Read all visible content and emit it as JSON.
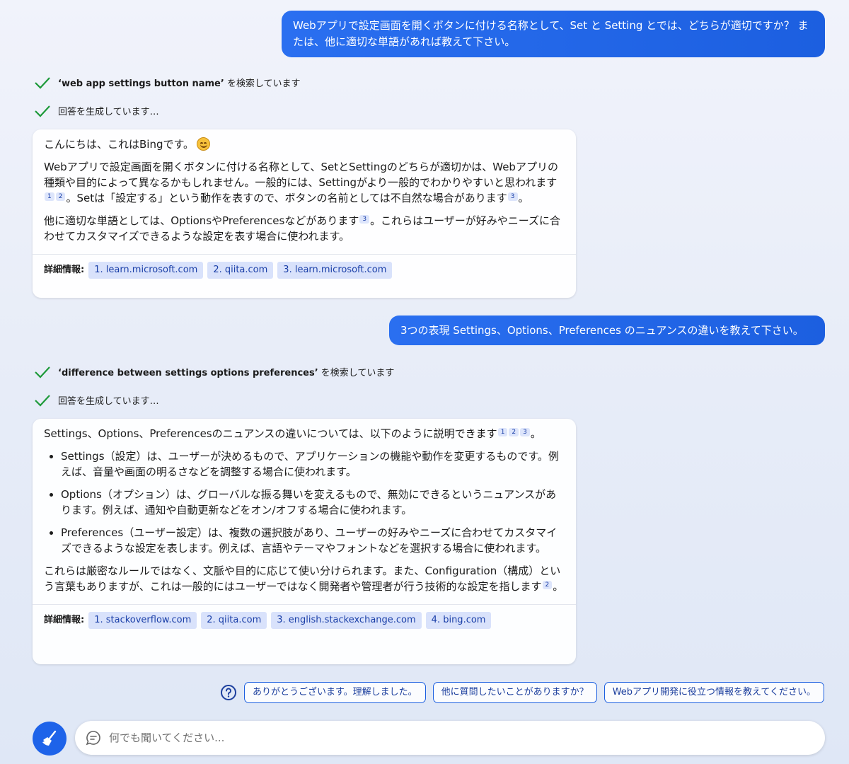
{
  "conversation": {
    "user_msg_1": "Webアプリで設定画面を開くボタンに付ける名称として、Set と Setting とでは、どちらが適切ですか？ または、他に適切な単語があれば教えて下さい。",
    "status_1": {
      "query": "‘web app settings button name’",
      "suffix": " を検索しています"
    },
    "status_2": "回答を生成しています…",
    "bot_1": {
      "greeting": "こんにちは、これはBingです。",
      "p1_a": "Webアプリで設定画面を開くボタンに付ける名称として、SetとSettingのどちらが適切かは、Webアプリの種類や目的によって異なるかもしれません。一般的には、Settingがより一般的でわかりやすいと思われます",
      "p1_b": "。Setは「設定する」という動作を表すので、ボタンの名前としては不自然な場合があります",
      "p1_c": "。",
      "p2_a": "他に適切な単語としては、OptionsやPreferencesなどがあります",
      "p2_b": "。これらはユーザーが好みやニーズに合わせてカスタマイズできるような設定を表す場合に使われます。",
      "sources_label": "詳細情報:",
      "sources": [
        "1. learn.microsoft.com",
        "2. qiita.com",
        "3. learn.microsoft.com"
      ]
    },
    "user_msg_2": "3つの表現 Settings、Options、Preferences のニュアンスの違いを教えて下さい。",
    "status_3": {
      "query": "‘difference between settings options preferences’",
      "suffix": " を検索しています"
    },
    "status_4": "回答を生成しています…",
    "bot_2": {
      "intro": "Settings、Options、Preferencesのニュアンスの違いについては、以下のように説明できます",
      "intro_end": "。",
      "bullet_1": "Settings（設定）は、ユーザーが決めるもので、アプリケーションの機能や動作を変更するものです。例えば、音量や画面の明るさなどを調整する場合に使われます。",
      "bullet_2": "Options（オプション）は、グローバルな振る舞いを変えるもので、無効にできるというニュアンスがあります。例えば、通知や自動更新などをオン/オフする場合に使われます。",
      "bullet_3": "Preferences（ユーザー設定）は、複数の選択肢があり、ユーザーの好みやニーズに合わせてカスタマイズできるような設定を表します。例えば、言語やテーマやフォントなどを選択する場合に使われます。",
      "outro": "これらは厳密なルールではなく、文脈や目的に応じて使い分けられます。また、Configuration（構成）という言葉もありますが、これは一般的にはユーザーではなく開発者や管理者が行う技術的な設定を指します",
      "outro_end": "。",
      "sources_label": "詳細情報:",
      "sources": [
        "1. stackoverflow.com",
        "2. qiita.com",
        "3. english.stackexchange.com",
        "4. bing.com"
      ]
    },
    "citations": {
      "c1": "1",
      "c2": "2",
      "c3": "3"
    }
  },
  "suggestions": [
    "ありがとうございます。理解しました。",
    "他に質問したいことがありますか？",
    "Webアプリ開発に役立つ情報を教えてください。"
  ],
  "composer": {
    "placeholder": "何でも聞いてください..."
  },
  "colors": {
    "accent": "#1e63e9",
    "chip_bg": "#d9e2fb",
    "check": "#1e9a3a"
  },
  "icons": {
    "check": "check-icon",
    "help": "question-icon",
    "new_topic": "broom-icon",
    "chat": "chat-bubble-icon"
  }
}
